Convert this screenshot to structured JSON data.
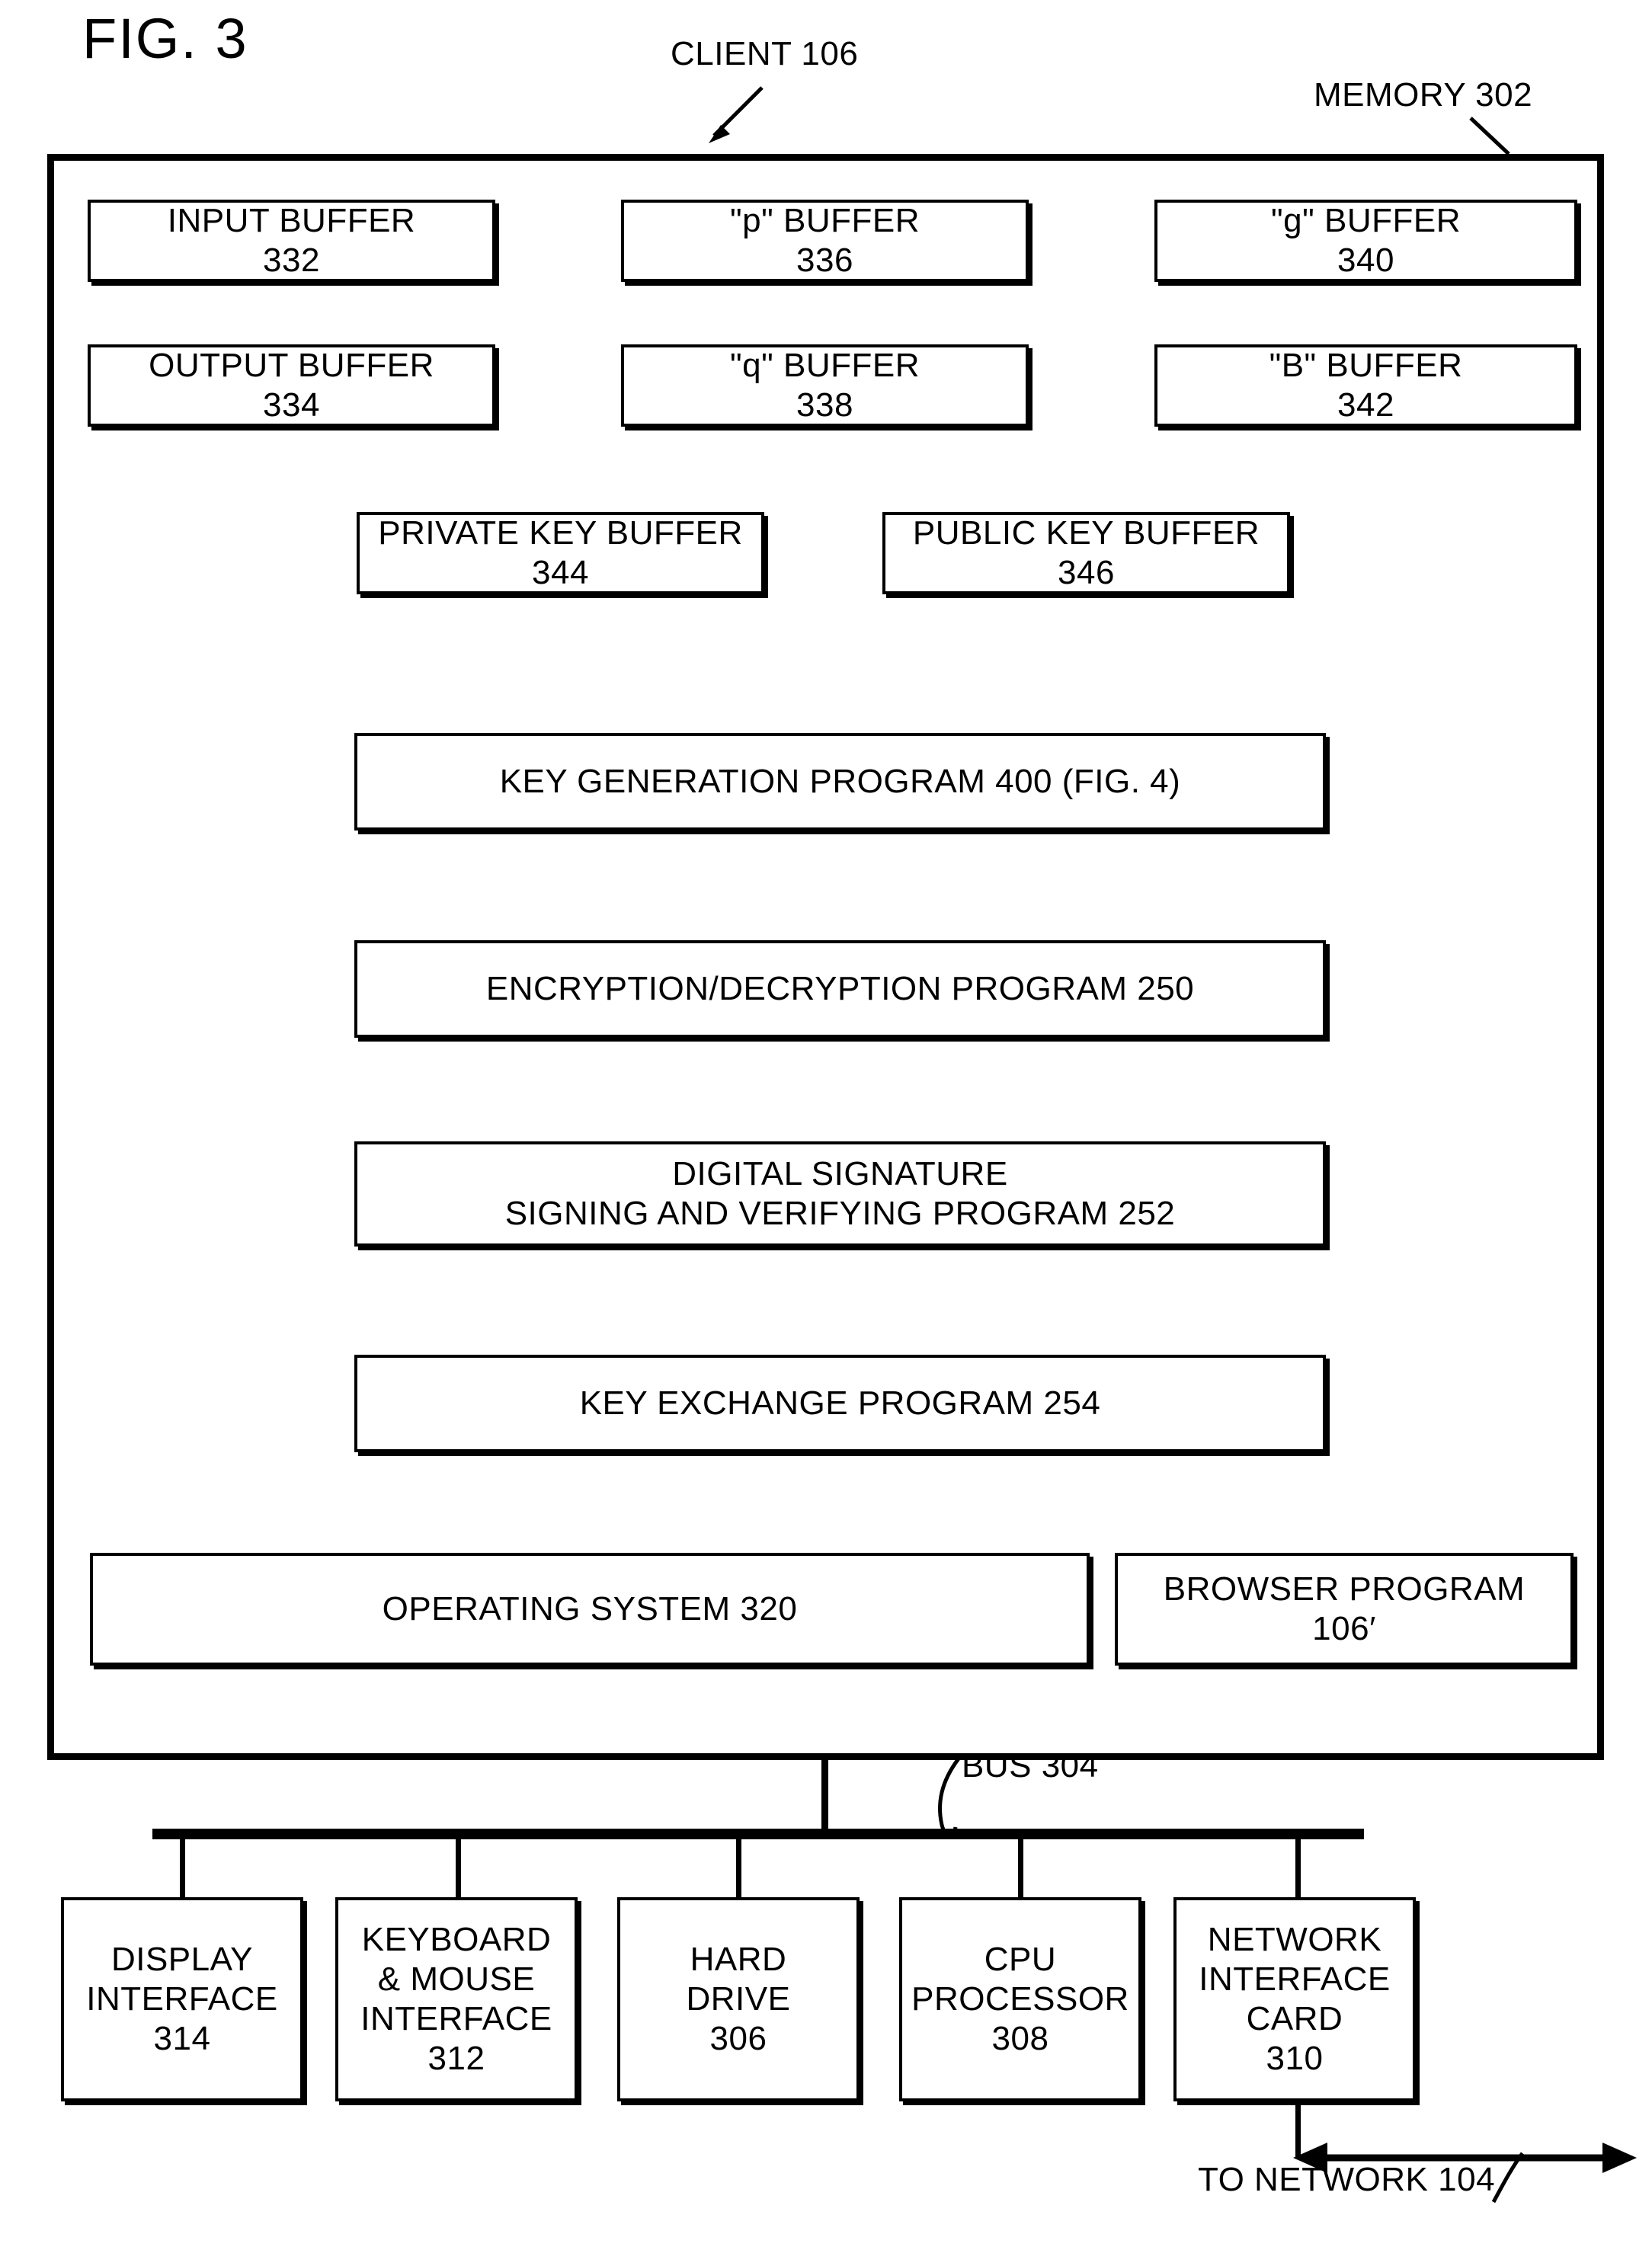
{
  "figure": {
    "title": "FIG. 3",
    "client_label": "CLIENT 106",
    "memory_label": "MEMORY 302",
    "bus_label": "BUS 304",
    "network_label": "TO NETWORK 104"
  },
  "buffers": [
    {
      "name": "INPUT BUFFER",
      "number": "332"
    },
    {
      "name": "OUTPUT BUFFER",
      "number": "334"
    },
    {
      "name": "\"p\" BUFFER",
      "number": "336"
    },
    {
      "name": "\"q\" BUFFER",
      "number": "338"
    },
    {
      "name": "\"g\" BUFFER",
      "number": "340"
    },
    {
      "name": "\"B\" BUFFER",
      "number": "342"
    },
    {
      "name": "PRIVATE KEY BUFFER",
      "number": "344"
    },
    {
      "name": "PUBLIC KEY BUFFER",
      "number": "346"
    }
  ],
  "programs": [
    {
      "line1": "KEY GENERATION PROGRAM 400 (FIG. 4)",
      "line2": ""
    },
    {
      "line1": "ENCRYPTION/DECRYPTION PROGRAM 250",
      "line2": ""
    },
    {
      "line1": "DIGITAL SIGNATURE",
      "line2": "SIGNING AND VERIFYING PROGRAM 252"
    },
    {
      "line1": "KEY EXCHANGE PROGRAM 254",
      "line2": ""
    }
  ],
  "system": {
    "operating_system": "OPERATING SYSTEM 320",
    "browser_line1": "BROWSER PROGRAM",
    "browser_line2": "106′"
  },
  "devices": [
    {
      "line1": "DISPLAY",
      "line2": "INTERFACE",
      "line3": "",
      "number": "314"
    },
    {
      "line1": "KEYBOARD",
      "line2": "& MOUSE",
      "line3": "INTERFACE",
      "number": "312"
    },
    {
      "line1": "HARD",
      "line2": "DRIVE",
      "line3": "",
      "number": "306"
    },
    {
      "line1": "CPU",
      "line2": "PROCESSOR",
      "line3": "",
      "number": "308"
    },
    {
      "line1": "NETWORK",
      "line2": "INTERFACE",
      "line3": "CARD",
      "number": "310"
    }
  ],
  "colors": {
    "ink": "#000000",
    "paper": "#ffffff"
  }
}
